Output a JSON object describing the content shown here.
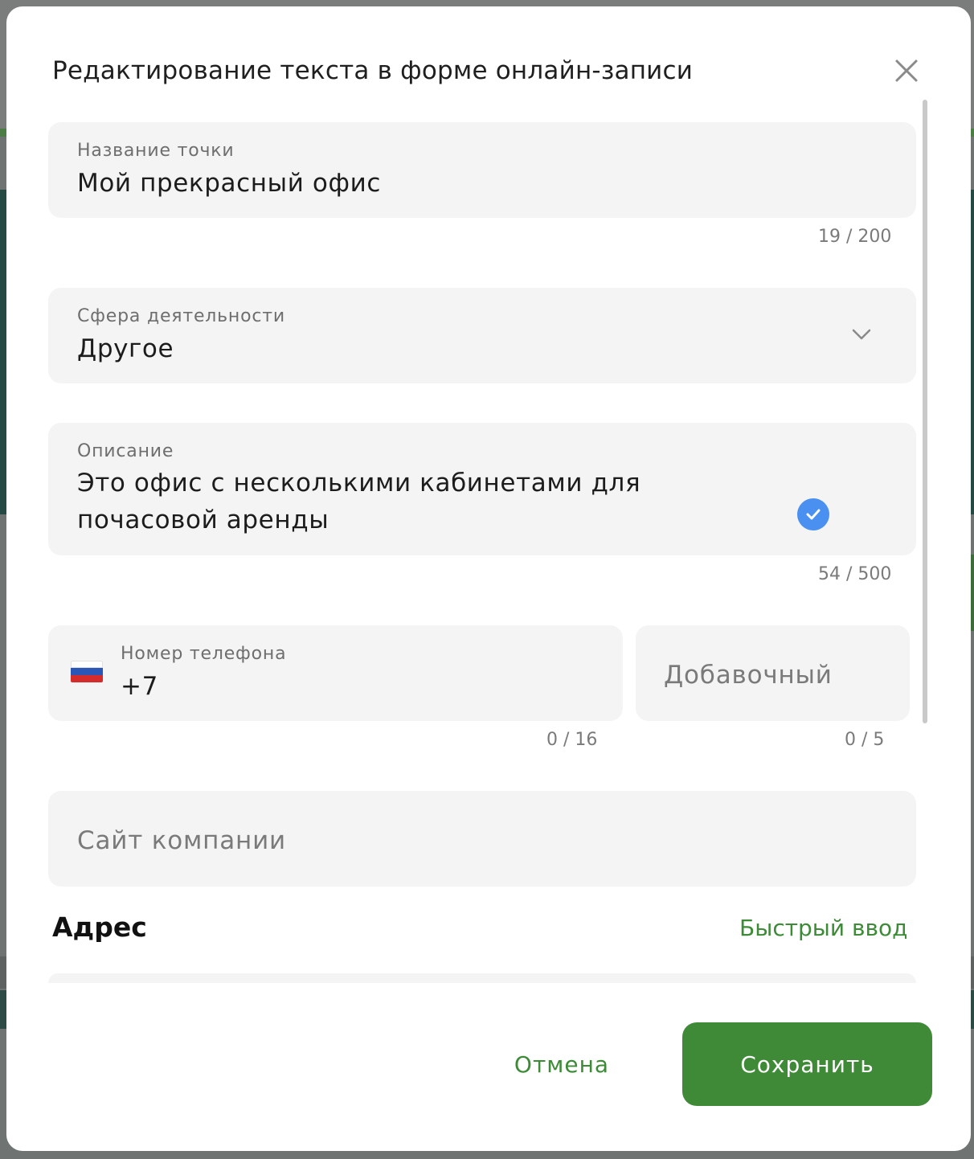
{
  "dialog": {
    "title": "Редактирование текста в форме онлайн-записи"
  },
  "fields": {
    "name": {
      "label": "Название точки",
      "value": "Мой прекрасный офис",
      "counter": "19 / 200"
    },
    "sphere": {
      "label": "Сфера деятельности",
      "value": "Другое"
    },
    "description": {
      "label": "Описание",
      "value": "Это офис с несколькими кабинетами для почасовой аренды",
      "counter": "54 / 500"
    },
    "phone": {
      "label": "Номер телефона",
      "value": "+7",
      "counter": "0 / 16"
    },
    "extension": {
      "placeholder": "Добавочный",
      "counter": "0 / 5"
    },
    "website": {
      "placeholder": "Сайт компании"
    }
  },
  "address": {
    "title": "Адрес",
    "quick_input": "Быстрый ввод"
  },
  "footer": {
    "cancel_label": "Отмена",
    "save_label": "Сохранить"
  },
  "colors": {
    "accent_green": "#3f8a37",
    "check_blue": "#4a90f0",
    "field_bg": "#f4f4f4"
  },
  "icons": {
    "close": "close-icon",
    "dropdown": "chevron-down-icon",
    "valid": "check-circle-icon",
    "flag": "russia-flag-icon"
  }
}
